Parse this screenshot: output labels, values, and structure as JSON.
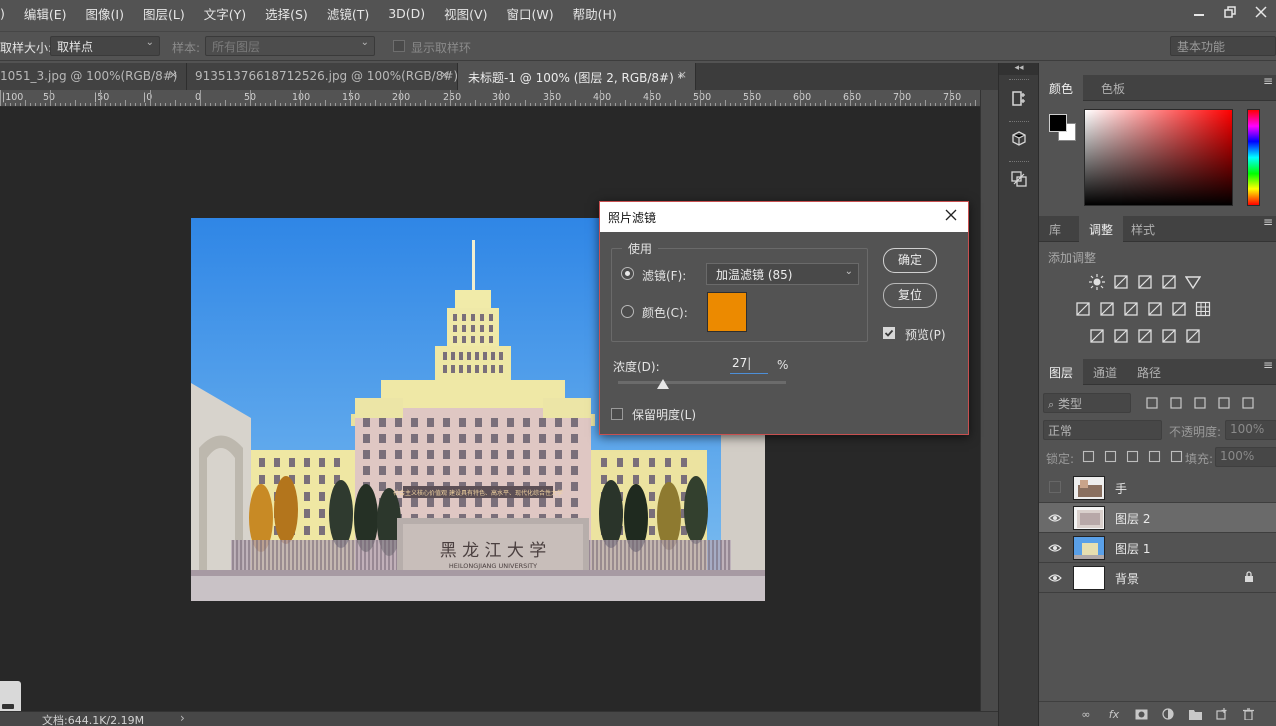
{
  "menu": [
    "编辑(E)",
    "图像(I)",
    "图层(L)",
    "文字(Y)",
    "选择(S)",
    "滤镜(T)",
    "3D(D)",
    "视图(V)",
    "窗口(W)",
    "帮助(H)"
  ],
  "menu_partial": ")",
  "options": {
    "sample_size_label": "取样大小:",
    "sample_size_value": "取样点",
    "sample_label": "样本:",
    "sample_value": "所有图层",
    "show_ring_label": "显示取样环",
    "workspace": "基本功能"
  },
  "tabs": [
    {
      "label": "1051_3.jpg @ 100%(RGB/8#)",
      "close": "×"
    },
    {
      "label": "91351376618712526.jpg @ 100%(RGB/8#)",
      "close": "×"
    },
    {
      "label": "未标题-1 @ 100% (图层 2, RGB/8#) *",
      "close": "×"
    }
  ],
  "ruler_labels": [
    "50",
    "0",
    "50",
    "100",
    "150",
    "200",
    "250",
    "300",
    "350",
    "400",
    "450",
    "500",
    "550",
    "600",
    "650",
    "700",
    "750"
  ],
  "ruler_left_labels": [
    "|100",
    "|50",
    "|0"
  ],
  "status": {
    "doc": "文档:644.1K/2.19M",
    "arrow": "›"
  },
  "color_panel": {
    "tabs": [
      "颜色",
      "色板"
    ]
  },
  "adjust_panel": {
    "tabs": [
      "库",
      "调整",
      "样式"
    ],
    "title": "添加调整"
  },
  "layers_panel": {
    "tabs": [
      "图层",
      "通道",
      "路径"
    ],
    "filter_kind": "类型",
    "blend_mode": "正常",
    "opacity_label": "不透明度:",
    "opacity_value": "100%",
    "lock_label": "锁定:",
    "fill_label": "填充:",
    "fill_value": "100%",
    "layers": [
      {
        "name": "手",
        "visible": false
      },
      {
        "name": "图层 2",
        "visible": true
      },
      {
        "name": "图层 1",
        "visible": true
      },
      {
        "name": "背景",
        "visible": true,
        "locked": true
      }
    ]
  },
  "dialog": {
    "title": "照片滤镜",
    "group_label": "使用",
    "filter_label": "滤镜(F):",
    "filter_value": "加温滤镜 (85)",
    "color_label": "颜色(C):",
    "swatch_color": "#ec8a00",
    "density_label": "浓度(D):",
    "density_value": "27",
    "density_unit": "%",
    "density_fraction": 0.27,
    "preserve_label": "保留明度(L)",
    "ok_label": "确定",
    "reset_label": "复位",
    "preview_label": "预览(P)"
  },
  "photo_text": {
    "banner": "社会主义核心价值观 建设具有特色、高水平、现代化综合性大学",
    "sign_cn": "黑 龙 江 大 学",
    "sign_en": "HEILONGJIANG UNIVERSITY"
  }
}
